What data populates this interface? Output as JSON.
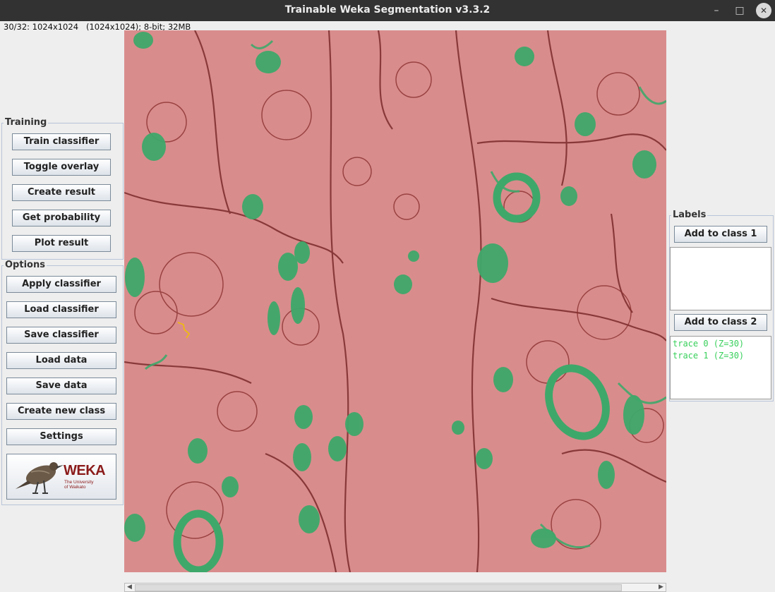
{
  "window": {
    "title": "Trainable Weka Segmentation v3.3.2",
    "minimize_glyph": "–",
    "maximize_glyph": "□",
    "close_glyph": "✕"
  },
  "image_info": "30/32: 1024x1024   (1024x1024); 8-bit; 32MB",
  "training": {
    "title": "Training",
    "buttons": [
      "Train classifier",
      "Toggle overlay",
      "Create result",
      "Get probability",
      "Plot result"
    ]
  },
  "options": {
    "title": "Options",
    "buttons": [
      "Apply classifier",
      "Load classifier",
      "Save classifier",
      "Load data",
      "Save data",
      "Create new class",
      "Settings"
    ]
  },
  "logo": {
    "brand": "WEKA",
    "subtitle_line1": "The University",
    "subtitle_line2": "of Waikato"
  },
  "labels": {
    "title": "Labels",
    "class1_button": "Add to class 1",
    "class2_button": "Add to class 2",
    "class1_traces": [],
    "class2_traces": [
      "trace 0 (Z=30)",
      "trace 1 (Z=30)"
    ]
  },
  "colors": {
    "class1_overlay": "#d98c8c",
    "class2_overlay": "#3ea86a",
    "membrane": "#7a2a2a",
    "trace": "#37d05a",
    "annotation": "#f0c000"
  },
  "scrollbar": {
    "left_arrow": "◀",
    "right_arrow": "▶"
  }
}
